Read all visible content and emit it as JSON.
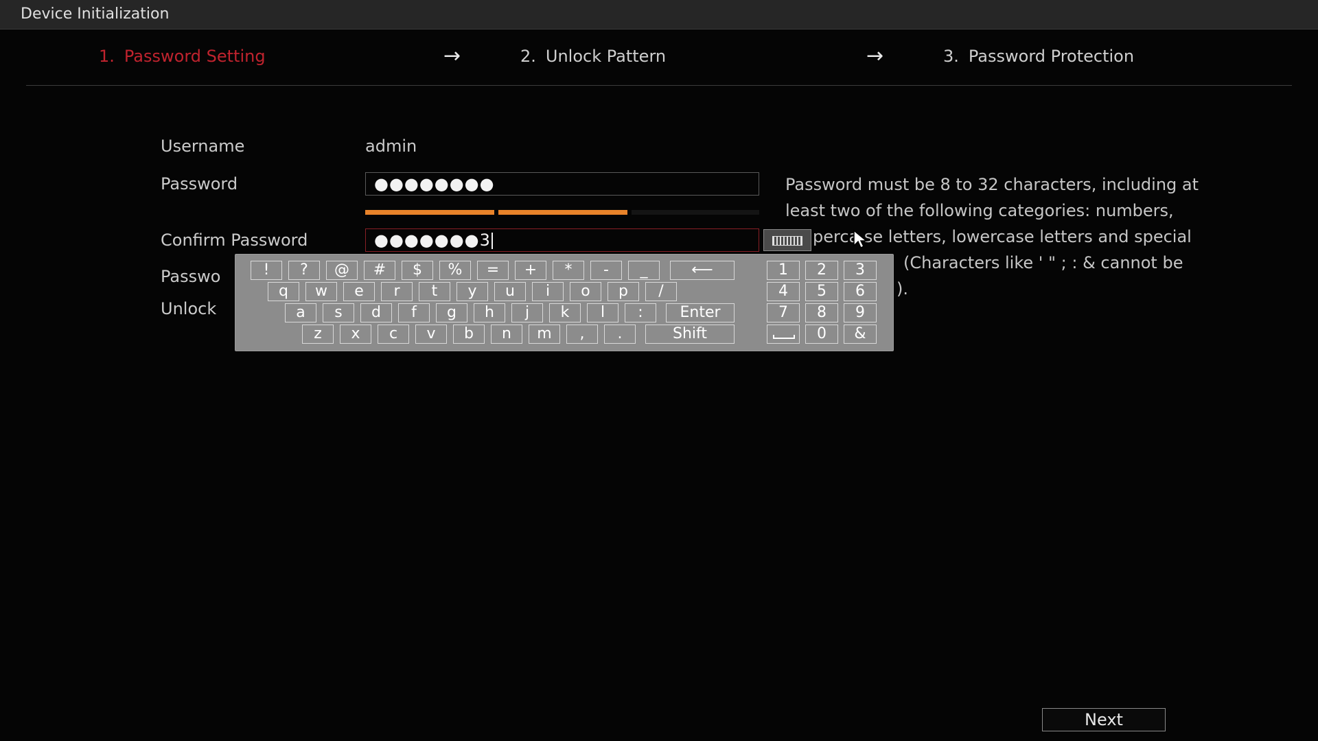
{
  "window": {
    "title": "Device Initialization"
  },
  "steps": [
    {
      "num": "1.",
      "label": "Password Setting",
      "active": true
    },
    {
      "num": "2.",
      "label": "Unlock Pattern",
      "active": false
    },
    {
      "num": "3.",
      "label": "Password Protection",
      "active": false
    }
  ],
  "step_arrow": "→",
  "form": {
    "username_label": "Username",
    "username_value": "admin",
    "password_label": "Password",
    "password_value": "●●●●●●●●",
    "password_strength_percent": 67,
    "confirm_label": "Confirm Password",
    "confirm_value": "●●●●●●●3",
    "password_hint_label_partial": "Passwo",
    "unlock_label_partial": "Unlock"
  },
  "hint": {
    "line1": "Password must be 8 to 32 characters, including at",
    "line2": "least two of the following categories: numbers,",
    "line3": "perca se letters, lowercase letters and special",
    "line4": "(Characters like ' \" ; : & cannot be",
    "line5": ")."
  },
  "keyboard": {
    "row1": [
      "!",
      "?",
      "@",
      "#",
      "$",
      "%",
      "=",
      "+",
      "*",
      "-",
      "_"
    ],
    "backspace": "⟵",
    "row2": [
      "q",
      "w",
      "e",
      "r",
      "t",
      "y",
      "u",
      "i",
      "o",
      "p",
      "/"
    ],
    "row3": [
      "a",
      "s",
      "d",
      "f",
      "g",
      "h",
      "j",
      "k",
      "l",
      ":"
    ],
    "enter": "Enter",
    "row4": [
      "z",
      "x",
      "c",
      "v",
      "b",
      "n",
      "m",
      ",",
      "."
    ],
    "shift": "Shift",
    "numpad": [
      "1",
      "2",
      "3",
      "4",
      "5",
      "6",
      "7",
      "8",
      "9"
    ],
    "zero": "0",
    "amp": "&"
  },
  "buttons": {
    "next": "Next"
  },
  "colors": {
    "active_step": "#c0232e",
    "strength_bar": "#e8832a",
    "error_border": "#8a1f25"
  },
  "icons": {
    "keyboard_toggle": "keyboard-icon",
    "mouse_cursor": "mouse-pointer-icon",
    "space_key": "space-bar-icon"
  }
}
